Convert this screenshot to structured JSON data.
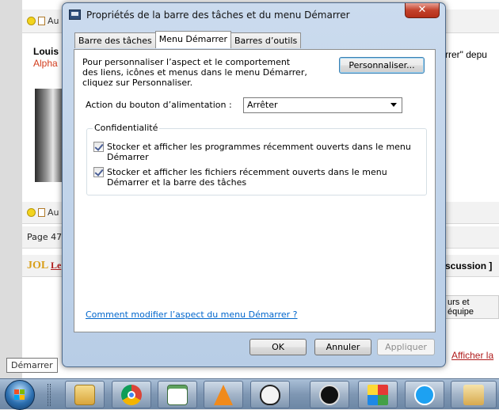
{
  "background": {
    "toolbar_text": "Au",
    "author_name": "Louis",
    "author_rank": "Alpha",
    "page_count": "Page 47 s",
    "jol_logo": "JOL",
    "jol_link": "Le",
    "right_texts": {
      "depuis": "rrer\" depu",
      "discussion": "scussion ]",
      "equipe": "urs et équipe",
      "afficher": "Afficher la"
    }
  },
  "tooltip": "Démarrer",
  "dialog": {
    "title": "Propriétés de la barre des tâches et du menu Démarrer",
    "close_label": "✕",
    "tabs": [
      {
        "label": "Barre des tâches"
      },
      {
        "label": "Menu Démarrer"
      },
      {
        "label": "Barres d’outils"
      }
    ],
    "intro_text": "Pour personnaliser l’aspect et le comportement des liens, icônes et menus dans le menu Démarrer, cliquez sur Personnaliser.",
    "customize_button": "Personnaliser...",
    "power_label": "Action du bouton d’alimentation :",
    "power_value": "Arrêter",
    "privacy_legend": "Confidentialité",
    "checkboxes": [
      {
        "label": "Stocker et afficher les programmes récemment ouverts dans le menu Démarrer",
        "checked": true
      },
      {
        "label": "Stocker et afficher les fichiers récemment ouverts dans le menu Démarrer et la barre des tâches",
        "checked": true
      }
    ],
    "help_link": "Comment modifier l’aspect du menu Démarrer ?",
    "ok_button": "OK",
    "cancel_button": "Annuler",
    "apply_button": "Appliquer"
  },
  "taskbar": {
    "apps": [
      {
        "icon": "folder-icon"
      },
      {
        "icon": "chrome-icon"
      },
      {
        "icon": "notepad-icon"
      },
      {
        "icon": "vlc-icon"
      },
      {
        "icon": "alien-icon"
      },
      {
        "icon": "ble-icon"
      },
      {
        "icon": "grid-app-icon"
      },
      {
        "icon": "skype-icon"
      },
      {
        "icon": "avatar-app-icon"
      }
    ]
  }
}
